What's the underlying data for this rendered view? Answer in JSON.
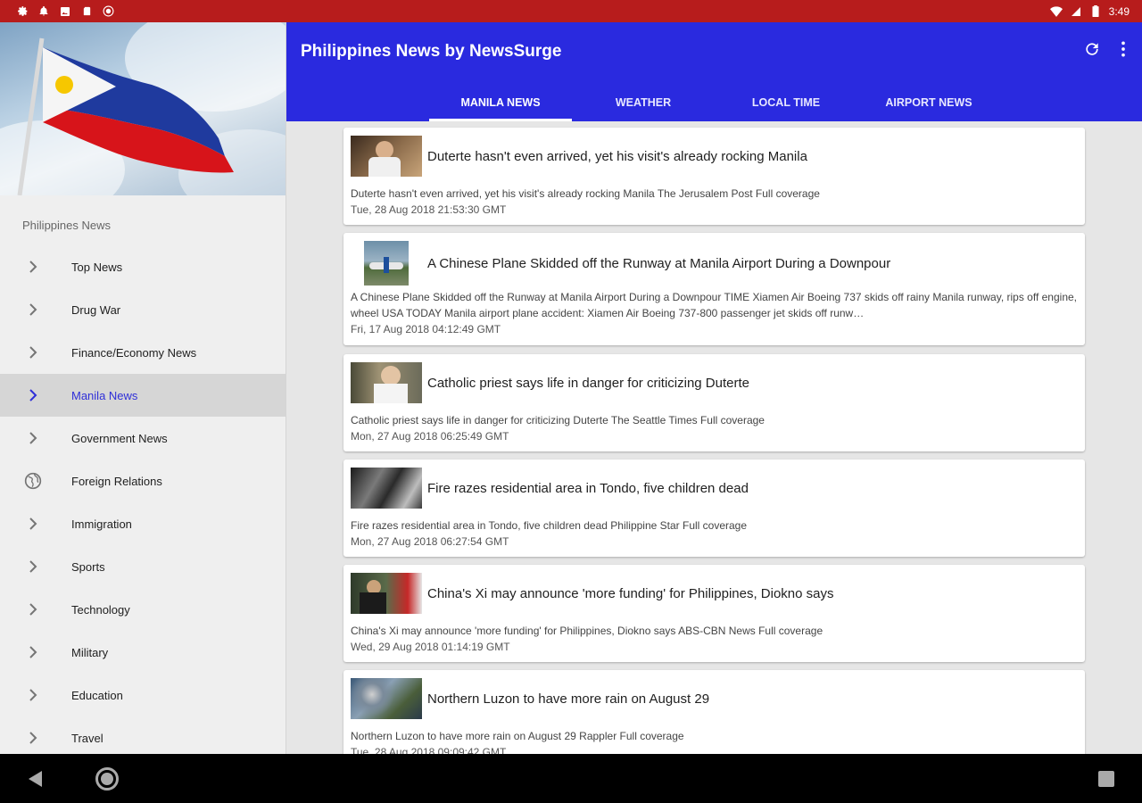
{
  "status_bar": {
    "time": "3:49",
    "left_icons": [
      "gear-icon",
      "bell-icon",
      "image-icon",
      "sd-card-icon",
      "record-icon"
    ],
    "right_icons": [
      "wifi-icon",
      "signal-icon",
      "battery-icon"
    ]
  },
  "app_bar": {
    "title": "Philippines News by NewsSurge",
    "actions": [
      "refresh-icon",
      "more-vert-icon"
    ]
  },
  "tabs": [
    {
      "label": "MANILA NEWS",
      "active": true
    },
    {
      "label": "WEATHER",
      "active": false
    },
    {
      "label": "LOCAL TIME",
      "active": false
    },
    {
      "label": "AIRPORT NEWS",
      "active": false
    }
  ],
  "drawer": {
    "section": "Philippines News",
    "items": [
      {
        "label": "Top News",
        "icon": "chevron-right-icon"
      },
      {
        "label": "Drug War",
        "icon": "chevron-right-icon"
      },
      {
        "label": "Finance/Economy News",
        "icon": "chevron-right-icon"
      },
      {
        "label": "Manila News",
        "icon": "chevron-right-icon",
        "active": true
      },
      {
        "label": "Government News",
        "icon": "chevron-right-icon"
      },
      {
        "label": "Foreign Relations",
        "icon": "globe-icon"
      },
      {
        "label": "Immigration",
        "icon": "chevron-right-icon"
      },
      {
        "label": "Sports",
        "icon": "chevron-right-icon"
      },
      {
        "label": "Technology",
        "icon": "chevron-right-icon"
      },
      {
        "label": "Military",
        "icon": "chevron-right-icon"
      },
      {
        "label": "Education",
        "icon": "chevron-right-icon"
      },
      {
        "label": "Travel",
        "icon": "chevron-right-icon"
      }
    ]
  },
  "articles": [
    {
      "title": "Duterte hasn't even arrived, yet his visit's already rocking Manila",
      "description": "Duterte hasn't even arrived, yet his visit's already rocking Manila  The Jerusalem Post  Full coverage",
      "date": "Tue, 28 Aug 2018 21:53:30 GMT"
    },
    {
      "title": "A Chinese Plane Skidded off the Runway at Manila Airport During a Downpour",
      "description": "A Chinese Plane Skidded off the Runway at Manila Airport During a Downpour  TIME  Xiamen Air Boeing 737 skids off rainy Manila runway, rips off engine, wheel  USA TODAY  Manila airport plane accident: Xiamen Air Boeing 737-800 passenger jet skids off runw…",
      "date": "Fri, 17 Aug 2018 04:12:49 GMT"
    },
    {
      "title": "Catholic priest says life in danger for criticizing Duterte",
      "description": "Catholic priest says life in danger for criticizing Duterte  The Seattle Times  Full coverage",
      "date": "Mon, 27 Aug 2018 06:25:49 GMT"
    },
    {
      "title": "Fire razes residential area in Tondo, five children dead",
      "description": "Fire razes residential area in Tondo, five children dead  Philippine Star  Full coverage",
      "date": "Mon, 27 Aug 2018 06:27:54 GMT"
    },
    {
      "title": "China's Xi may announce 'more funding' for Philippines, Diokno says",
      "description": "China's Xi may announce 'more funding' for Philippines, Diokno says  ABS-CBN News  Full coverage",
      "date": "Wed, 29 Aug 2018 01:14:19 GMT"
    },
    {
      "title": "Northern Luzon to have more rain on August 29",
      "description": "Northern Luzon to have more rain on August 29  Rappler  Full coverage",
      "date": "Tue, 28 Aug 2018 09:09:42 GMT"
    }
  ],
  "nav_bar": [
    "back-icon",
    "home-icon",
    "recents-icon"
  ],
  "colors": {
    "status_bar": "#b71c1c",
    "app_bar": "#2a2adf",
    "active_drawer_text": "#2f2fd8"
  }
}
